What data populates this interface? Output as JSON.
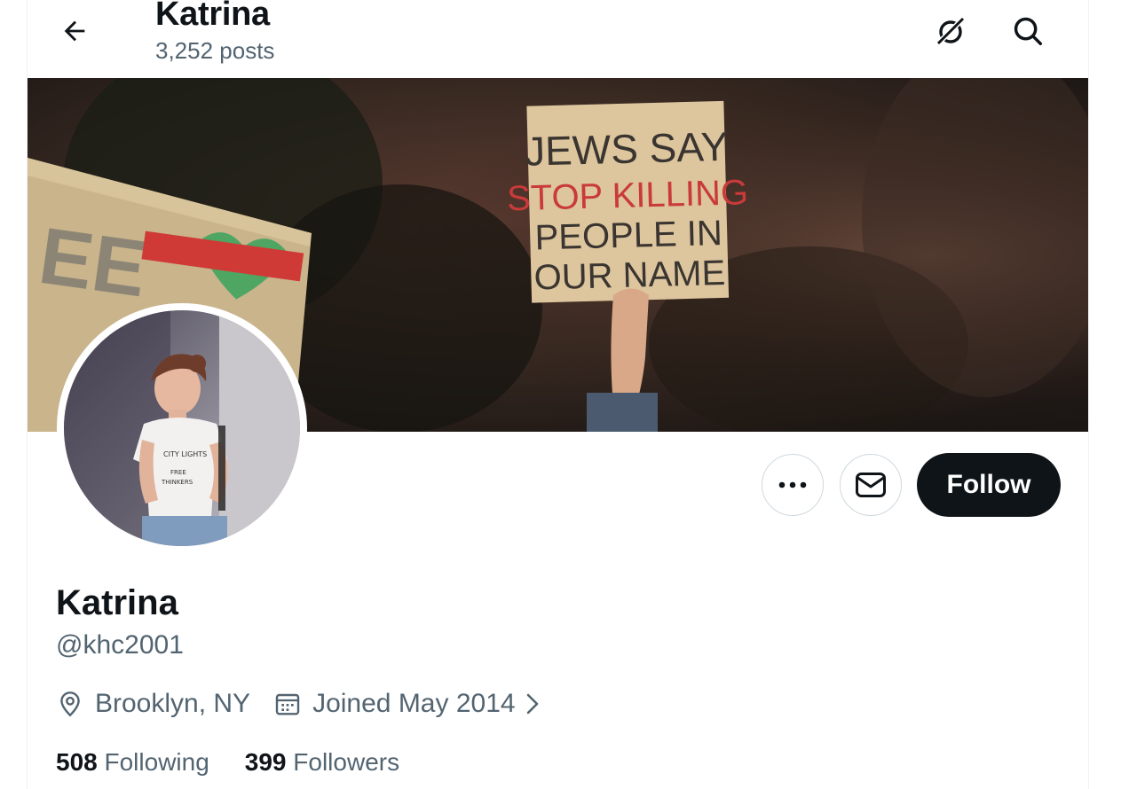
{
  "header": {
    "title": "Katrina",
    "post_count": "3,252 posts"
  },
  "banner": {
    "sign_lines": [
      "JEWS SAY",
      "STOP KILLING",
      "PEOPLE IN",
      "OUR NAME"
    ]
  },
  "actions": {
    "follow_label": "Follow"
  },
  "profile": {
    "display_name": "Katrina",
    "handle": "@khc2001",
    "location": "Brooklyn, NY",
    "joined": "Joined May 2014",
    "following_count": "508",
    "following_label": "Following",
    "followers_count": "399",
    "followers_label": "Followers"
  },
  "colors": {
    "text_primary": "#0f1419",
    "text_secondary": "#536471",
    "button_dark": "#0f1419",
    "border": "#cfd9de"
  }
}
